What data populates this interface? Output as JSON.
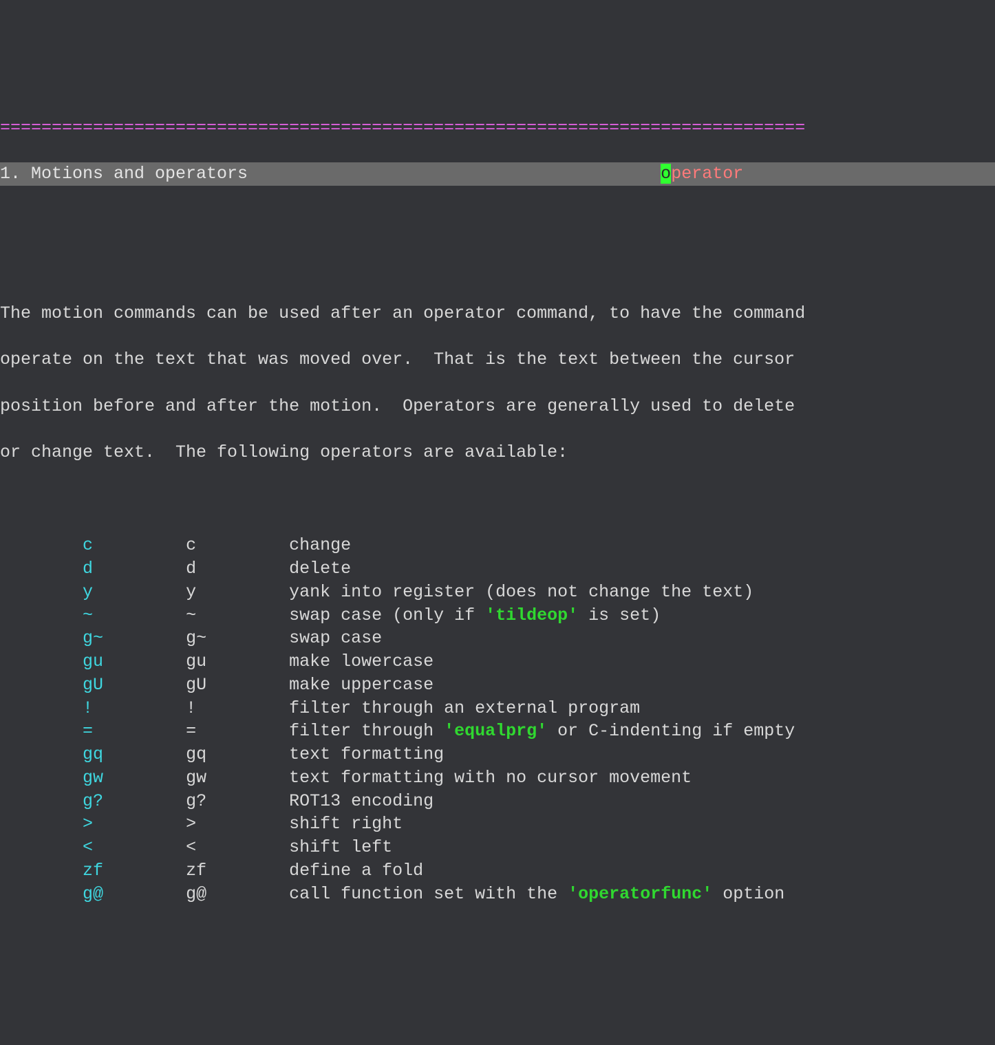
{
  "separator": "==============================================================================",
  "title_line": {
    "left": "1. Motions and operators",
    "gap": "                                        ",
    "cursor_char": "o",
    "tag_rest": "perator"
  },
  "para": {
    "l1": "The motion commands can be used after an operator command, to have the command",
    "l2": "operate on the text that was moved over.  That is the text between the cursor",
    "l3": "position before and after the motion.  Operators are generally used to delete",
    "l4": "or change text.  The following operators are available:"
  },
  "ops": [
    {
      "link": "c",
      "cmd": "c",
      "desc_pre": "change",
      "opt": "",
      "desc_post": ""
    },
    {
      "link": "d",
      "cmd": "d",
      "desc_pre": "delete",
      "opt": "",
      "desc_post": ""
    },
    {
      "link": "y",
      "cmd": "y",
      "desc_pre": "yank into register (does not change the text)",
      "opt": "",
      "desc_post": ""
    },
    {
      "link": "~",
      "cmd": "~",
      "desc_pre": "swap case (only if ",
      "opt": "'tildeop'",
      "desc_post": " is set)"
    },
    {
      "link": "g~",
      "cmd": "g~",
      "desc_pre": "swap case",
      "opt": "",
      "desc_post": ""
    },
    {
      "link": "gu",
      "cmd": "gu",
      "desc_pre": "make lowercase",
      "opt": "",
      "desc_post": ""
    },
    {
      "link": "gU",
      "cmd": "gU",
      "desc_pre": "make uppercase",
      "opt": "",
      "desc_post": ""
    },
    {
      "link": "!",
      "cmd": "!",
      "desc_pre": "filter through an external program",
      "opt": "",
      "desc_post": ""
    },
    {
      "link": "=",
      "cmd": "=",
      "desc_pre": "filter through ",
      "opt": "'equalprg'",
      "desc_post": " or C-indenting if empty"
    },
    {
      "link": "gq",
      "cmd": "gq",
      "desc_pre": "text formatting",
      "opt": "",
      "desc_post": ""
    },
    {
      "link": "gw",
      "cmd": "gw",
      "desc_pre": "text formatting with no cursor movement",
      "opt": "",
      "desc_post": ""
    },
    {
      "link": "g?",
      "cmd": "g?",
      "desc_pre": "ROT13 encoding",
      "opt": "",
      "desc_post": ""
    },
    {
      "link": ">",
      "cmd": ">",
      "desc_pre": "shift right",
      "opt": "",
      "desc_post": ""
    },
    {
      "link": "<",
      "cmd": "<",
      "desc_pre": "shift left",
      "opt": "",
      "desc_post": ""
    },
    {
      "link": "zf",
      "cmd": "zf",
      "desc_pre": "define a fold",
      "opt": "",
      "desc_post": ""
    },
    {
      "link": "g@",
      "cmd": "g@",
      "desc_pre": "call function set with the ",
      "opt": "'operatorfunc'",
      "desc_post": " option"
    }
  ],
  "indent": "        ",
  "col1_width": 10,
  "col2_width": 10
}
